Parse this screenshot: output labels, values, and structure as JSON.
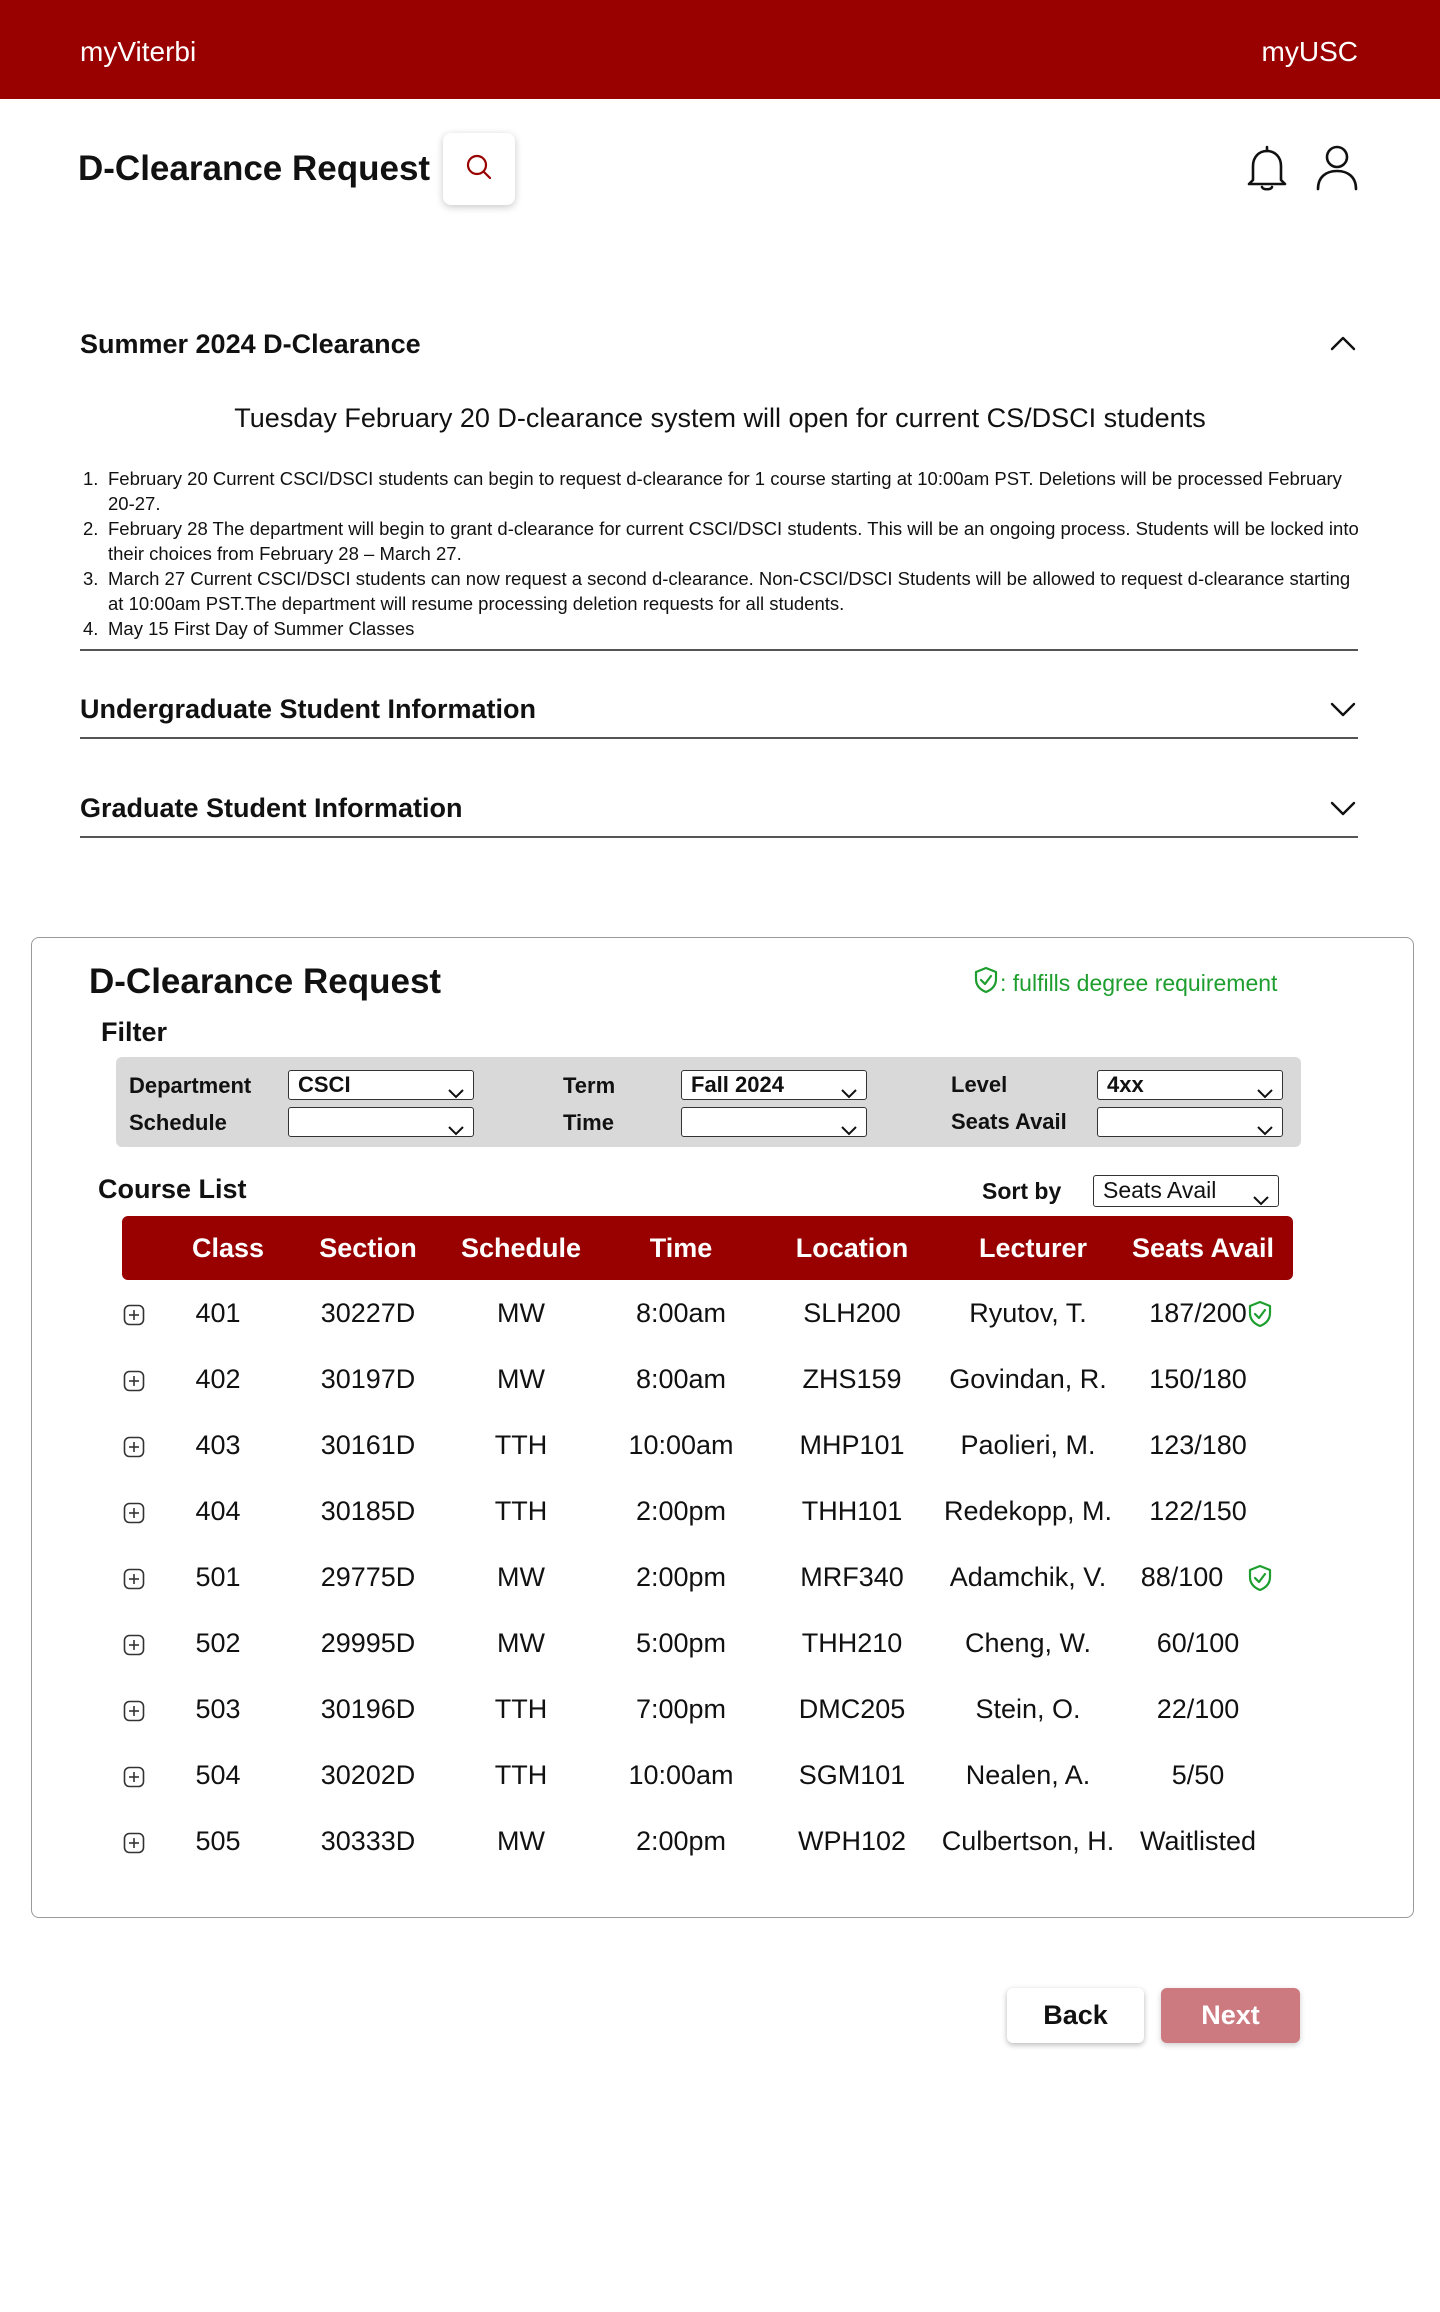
{
  "topbar": {
    "brand": "myViterbi",
    "link": "myUSC"
  },
  "header": {
    "title": "D-Clearance Request"
  },
  "accordion": {
    "summer": {
      "title": "Summer 2024 D-Clearance",
      "announcement": "Tuesday February 20 D-clearance system will open for current CS/DSCI students",
      "items": [
        {
          "num": "1.",
          "text": "February 20 Current CSCI/DSCI students can begin to request d-clearance for 1 course starting at 10:00am PST. Deletions will be processed February 20-27."
        },
        {
          "num": "2.",
          "text": "February 28 The department will begin to grant d-clearance for current CSCI/DSCI students. This will be an ongoing process. Students will be locked into their choices from February 28 – March 27."
        },
        {
          "num": "3.",
          "text": "March 27 Current CSCI/DSCI students can now request a second d-clearance. Non-CSCI/DSCI Students will be allowed to request d-clearance starting at 10:00am PST.The department will resume processing deletion requests for all students."
        },
        {
          "num": "4.",
          "text": "May 15 First Day of Summer Classes"
        }
      ]
    },
    "undergrad": {
      "title": "Undergraduate Student Information"
    },
    "grad": {
      "title": "Graduate Student Information"
    }
  },
  "request": {
    "title": "D-Clearance Request",
    "legend": ": fulfills degree requirement",
    "legend_color": "#1e9e2e",
    "filter": {
      "label": "Filter",
      "department_label": "Department",
      "department_value": "CSCI",
      "schedule_label": "Schedule",
      "schedule_value": "",
      "term_label": "Term",
      "term_value": "Fall 2024",
      "time_label": "Time",
      "time_value": "",
      "level_label": "Level",
      "level_value": "4xx",
      "seats_label": "Seats Avail",
      "seats_value": ""
    },
    "course_list_label": "Course List",
    "sort_label": "Sort by",
    "sort_value": "Seats Avail",
    "columns": [
      "Class",
      "Section",
      "Schedule",
      "Time",
      "Location",
      "Lecturer",
      "Seats Avail"
    ],
    "rows": [
      {
        "cls": "401",
        "section": "30227D",
        "schedule": "MW",
        "time": "8:00am",
        "location": "SLH200",
        "lecturer": "Ryutov, T.",
        "seats": "187/200",
        "fulfills": true
      },
      {
        "cls": "402",
        "section": "30197D",
        "schedule": "MW",
        "time": "8:00am",
        "location": "ZHS159",
        "lecturer": "Govindan, R.",
        "seats": "150/180",
        "fulfills": false
      },
      {
        "cls": "403",
        "section": "30161D",
        "schedule": "TTH",
        "time": "10:00am",
        "location": "MHP101",
        "lecturer": "Paolieri, M.",
        "seats": "123/180",
        "fulfills": false
      },
      {
        "cls": "404",
        "section": "30185D",
        "schedule": "TTH",
        "time": "2:00pm",
        "location": "THH101",
        "lecturer": "Redekopp, M.",
        "seats": "122/150",
        "fulfills": false
      },
      {
        "cls": "501",
        "section": "29775D",
        "schedule": "MW",
        "time": "2:00pm",
        "location": "MRF340",
        "lecturer": "Adamchik, V.",
        "seats": "88/100",
        "fulfills": true
      },
      {
        "cls": "502",
        "section": "29995D",
        "schedule": "MW",
        "time": "5:00pm",
        "location": "THH210",
        "lecturer": "Cheng, W.",
        "seats": "60/100",
        "fulfills": false
      },
      {
        "cls": "503",
        "section": "30196D",
        "schedule": "TTH",
        "time": "7:00pm",
        "location": "DMC205",
        "lecturer": "Stein, O.",
        "seats": "22/100",
        "fulfills": false
      },
      {
        "cls": "504",
        "section": "30202D",
        "schedule": "TTH",
        "time": "10:00am",
        "location": "SGM101",
        "lecturer": "Nealen, A.",
        "seats": "5/50",
        "fulfills": false
      },
      {
        "cls": "505",
        "section": "30333D",
        "schedule": "MW",
        "time": "2:00pm",
        "location": "WPH102",
        "lecturer": "Culbertson, H.",
        "seats": "Waitlisted",
        "fulfills": false
      }
    ]
  },
  "actions": {
    "back": "Back",
    "next": "Next"
  },
  "colors": {
    "brand": "#990000",
    "next_disabled": "#cc7a80"
  },
  "icons": {
    "search": "search-icon",
    "bell": "bell-icon",
    "user": "user-icon",
    "chevron_up": "chevron-up-icon",
    "chevron_down": "chevron-down-icon",
    "shield_check": "shield-check-icon",
    "expand": "plus-square-icon"
  }
}
